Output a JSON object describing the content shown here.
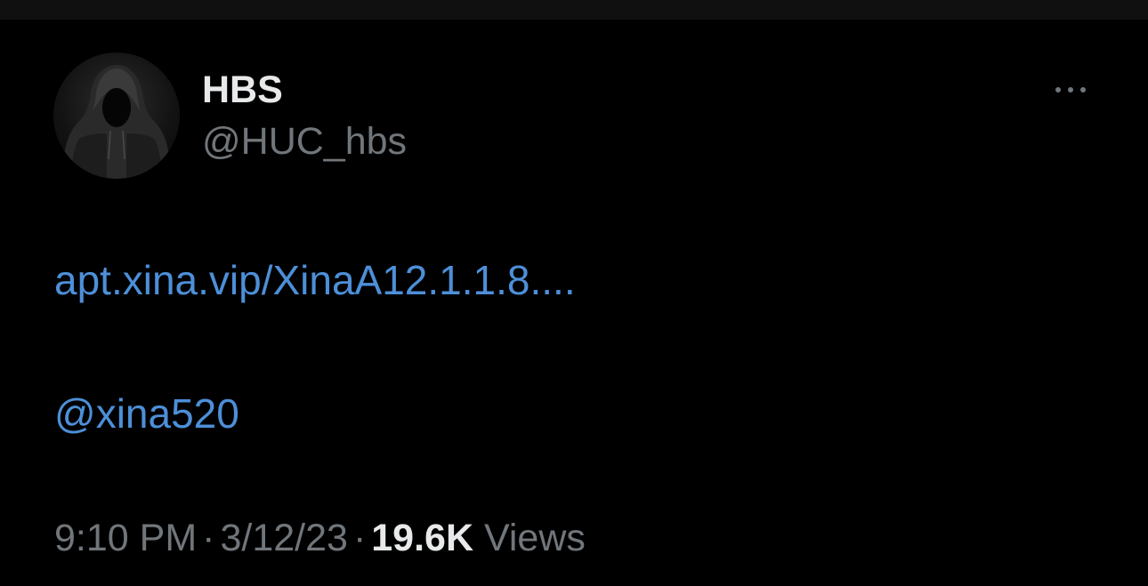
{
  "tweet": {
    "author": {
      "display_name": "HBS",
      "handle": "@HUC_hbs",
      "avatar_icon": "hooded-figure-avatar"
    },
    "more_icon": "more-horizontal-icon",
    "body": {
      "link_text": "apt.xina.vip/XinaA12.1.1.8....",
      "mention": "@xina520"
    },
    "meta": {
      "time": "9:10 PM",
      "separator": "·",
      "date": "3/12/23",
      "views_count": "19.6K",
      "views_label": "Views"
    }
  },
  "colors": {
    "background": "#000000",
    "primary_text": "#e7e9ea",
    "secondary_text": "#71767b",
    "link": "#4d8fd8"
  }
}
